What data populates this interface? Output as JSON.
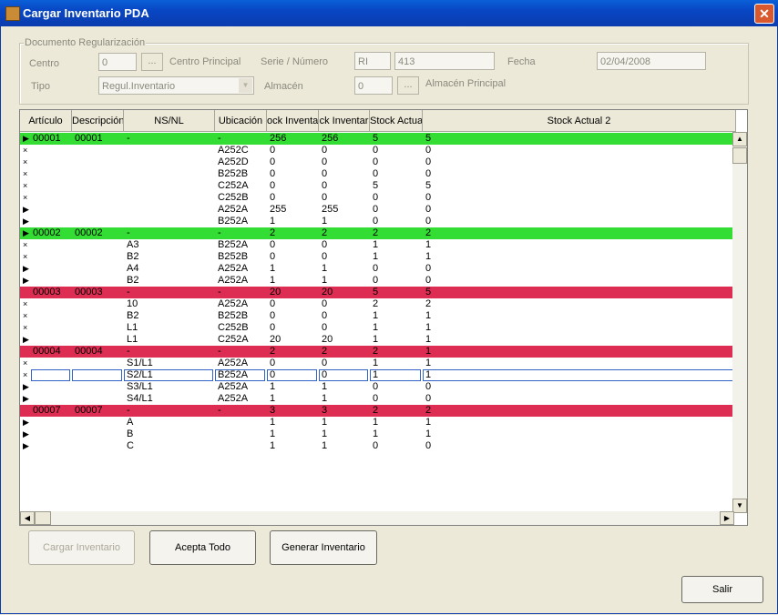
{
  "window": {
    "title": "Cargar Inventario PDA",
    "close_glyph": "✕"
  },
  "doc": {
    "legend": "Documento Regularización",
    "centro_label": "Centro",
    "centro_value": "0",
    "centro_btn": "...",
    "centro_desc": "Centro Principal",
    "serie_label": "Serie / Número",
    "serie_value": "RI",
    "numero_value": "413",
    "fecha_label": "Fecha",
    "fecha_value": "02/04/2008",
    "tipo_label": "Tipo",
    "tipo_value": "Regul.Inventario",
    "almacen_label": "Almacén",
    "almacen_value": "0",
    "almacen_btn": "...",
    "almacen_desc": "Almacén Principal"
  },
  "grid": {
    "columns": [
      "Artículo",
      "Descripción",
      "NS/NL",
      "Ubicación",
      "ock Inventa",
      "ck Inventar",
      "Stock Actua",
      "Stock Actual 2"
    ],
    "rows": [
      {
        "type": "group",
        "color": "green",
        "mark": "▶",
        "cells": [
          "00001",
          "00001",
          "-",
          "-",
          "256",
          "256",
          "5",
          "5"
        ]
      },
      {
        "mark": "×",
        "cells": [
          "",
          "",
          "",
          "A252C",
          "0",
          "0",
          "0",
          "0"
        ]
      },
      {
        "mark": "×",
        "cells": [
          "",
          "",
          "",
          "A252D",
          "0",
          "0",
          "0",
          "0"
        ]
      },
      {
        "mark": "×",
        "cells": [
          "",
          "",
          "",
          "B252B",
          "0",
          "0",
          "0",
          "0"
        ]
      },
      {
        "mark": "×",
        "cells": [
          "",
          "",
          "",
          "C252A",
          "0",
          "0",
          "5",
          "5"
        ]
      },
      {
        "mark": "×",
        "cells": [
          "",
          "",
          "",
          "C252B",
          "0",
          "0",
          "0",
          "0"
        ]
      },
      {
        "mark": "▶",
        "cells": [
          "",
          "",
          "",
          "A252A",
          "255",
          "255",
          "0",
          "0"
        ]
      },
      {
        "mark": "▶",
        "cells": [
          "",
          "",
          "",
          "B252A",
          "1",
          "1",
          "0",
          "0"
        ]
      },
      {
        "type": "group",
        "color": "green",
        "mark": "▶",
        "cells": [
          "00002",
          "00002",
          "-",
          "-",
          "2",
          "2",
          "2",
          "2"
        ]
      },
      {
        "mark": "×",
        "cells": [
          "",
          "",
          "A3",
          "B252A",
          "0",
          "0",
          "1",
          "1"
        ]
      },
      {
        "mark": "×",
        "cells": [
          "",
          "",
          "B2",
          "B252B",
          "0",
          "0",
          "1",
          "1"
        ]
      },
      {
        "mark": "▶",
        "cells": [
          "",
          "",
          "A4",
          "A252A",
          "1",
          "1",
          "0",
          "0"
        ]
      },
      {
        "mark": "▶",
        "cells": [
          "",
          "",
          "B2",
          "A252A",
          "1",
          "1",
          "0",
          "0"
        ]
      },
      {
        "type": "group",
        "color": "red",
        "mark": "",
        "cells": [
          "00003",
          "00003",
          "-",
          "-",
          "20",
          "20",
          "5",
          "5"
        ]
      },
      {
        "mark": "×",
        "cells": [
          "",
          "",
          "10",
          "A252A",
          "0",
          "0",
          "2",
          "2"
        ]
      },
      {
        "mark": "×",
        "cells": [
          "",
          "",
          "B2",
          "B252B",
          "0",
          "0",
          "1",
          "1"
        ]
      },
      {
        "mark": "×",
        "cells": [
          "",
          "",
          "L1",
          "C252B",
          "0",
          "0",
          "1",
          "1"
        ]
      },
      {
        "mark": "▶",
        "cells": [
          "",
          "",
          "L1",
          "C252A",
          "20",
          "20",
          "1",
          "1"
        ]
      },
      {
        "type": "group",
        "color": "red",
        "mark": "",
        "cells": [
          "00004",
          "00004",
          "-",
          "-",
          "2",
          "2",
          "2",
          "1"
        ]
      },
      {
        "mark": "×",
        "cells": [
          "",
          "",
          "S1/L1",
          "A252A",
          "0",
          "0",
          "1",
          "1"
        ]
      },
      {
        "mark": "×",
        "selected": true,
        "cells": [
          "",
          "",
          "S2/L1",
          "B252A",
          "0",
          "0",
          "1",
          "1"
        ]
      },
      {
        "mark": "▶",
        "cells": [
          "",
          "",
          "S3/L1",
          "A252A",
          "1",
          "1",
          "0",
          "0"
        ]
      },
      {
        "mark": "▶",
        "cells": [
          "",
          "",
          "S4/L1",
          "A252A",
          "1",
          "1",
          "0",
          "0"
        ]
      },
      {
        "type": "group",
        "color": "red",
        "mark": "",
        "cells": [
          "00007",
          "00007",
          "-",
          "-",
          "3",
          "3",
          "2",
          "2"
        ]
      },
      {
        "mark": "▶",
        "cells": [
          "",
          "",
          "A",
          "",
          "1",
          "1",
          "1",
          "1"
        ]
      },
      {
        "mark": "▶",
        "cells": [
          "",
          "",
          "B",
          "",
          "1",
          "1",
          "1",
          "1"
        ]
      },
      {
        "mark": "▶",
        "cells": [
          "",
          "",
          "C",
          "",
          "1",
          "1",
          "0",
          "0"
        ]
      }
    ]
  },
  "scroll": {
    "up": "▲",
    "down": "▼",
    "left": "◀",
    "right": "▶"
  },
  "buttons": {
    "cargar": "Cargar Inventario",
    "acepta": "Acepta Todo",
    "generar": "Generar Inventario",
    "salir": "Salir"
  }
}
